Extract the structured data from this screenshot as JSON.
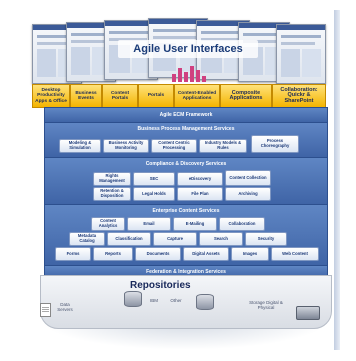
{
  "ui_title": "Agile User Interfaces",
  "ui_labels": [
    "Desktop Productivity Apps & Office",
    "Business Events",
    "Content Portals",
    "Portals",
    "Content-Enabled Applications",
    "Composite Applications",
    "Collaboration: Quickr & SharePoint"
  ],
  "framework": "Agile ECM Framework",
  "bpm": {
    "title": "Business Process Management Services",
    "items": [
      "Modeling & Simulation",
      "Business Activity Monitoring",
      "Content Centric Processing",
      "Industry Models & Rules",
      "Process Choreography"
    ]
  },
  "compliance": {
    "title": "Compliance & Discovery Services",
    "items": [
      "Rights Management",
      "SEC",
      "eDiscovery",
      "Content Collection",
      "Retention & Disposition",
      "Legal Holds",
      "File Plan",
      "Archiving"
    ]
  },
  "enterprise": {
    "title": "Enterprise Content Services",
    "items": [
      "Content Analytics",
      "Email",
      "E-Mailing",
      "Collaboration",
      "Metadata Catalog",
      "Classification",
      "Capture",
      "Search",
      "Security",
      "Forms",
      "Reports",
      "Documents",
      "Digital Assets",
      "Images",
      "Web Content"
    ]
  },
  "federation": "Federation & Integration Services",
  "repositories": {
    "title": "Repositories",
    "left": "Data Servers",
    "ibm": "IBM",
    "other": "Other",
    "storage": "Storage Digital & Physical"
  }
}
